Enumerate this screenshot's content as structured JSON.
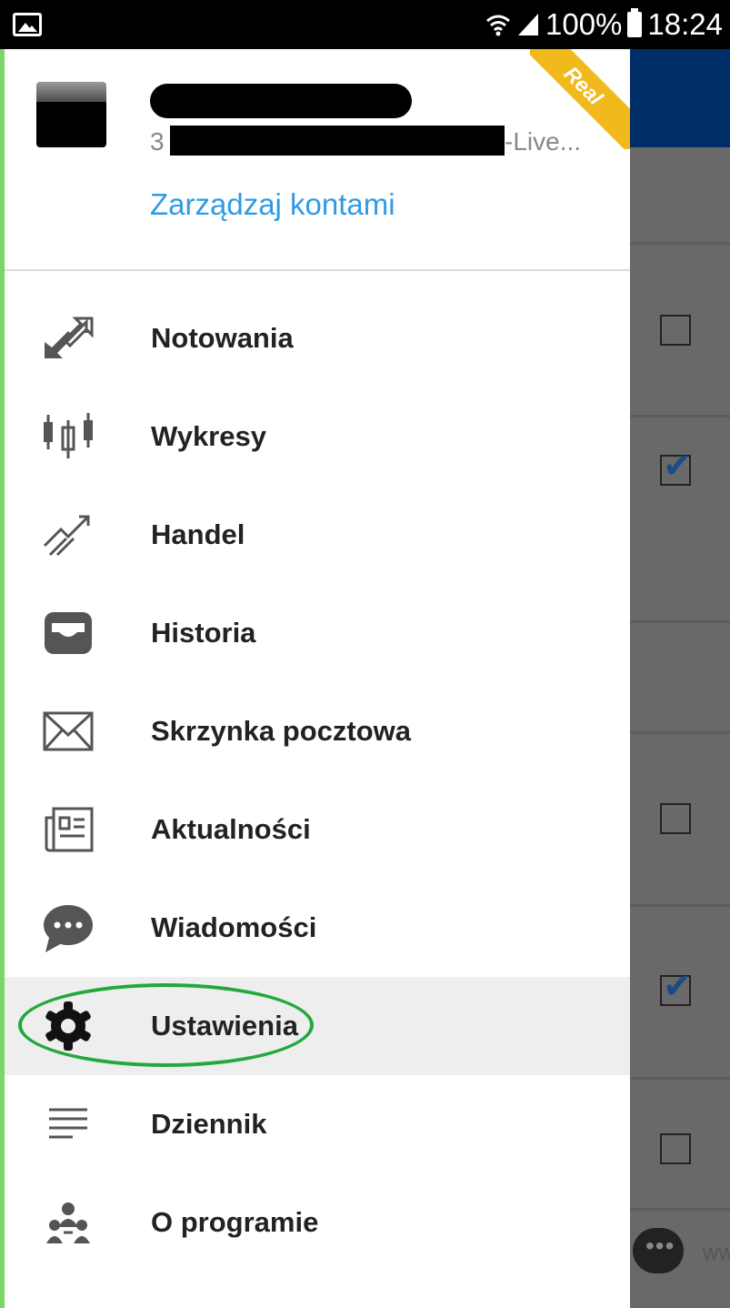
{
  "status_bar": {
    "battery": "100%",
    "time": "18:24",
    "icons": [
      "gallery-icon",
      "wifi-icon",
      "signal-icon",
      "battery-icon"
    ]
  },
  "drawer": {
    "account_number_prefix": "3",
    "account_suffix": "-Live...",
    "manage_accounts": "Zarządzaj kontami",
    "badge": "Real",
    "menu": [
      {
        "label": "Notowania",
        "icon": "quotes-arrows-icon"
      },
      {
        "label": "Wykresy",
        "icon": "candlestick-icon"
      },
      {
        "label": "Handel",
        "icon": "trade-trend-icon"
      },
      {
        "label": "Historia",
        "icon": "inbox-tray-icon"
      },
      {
        "label": "Skrzynka pocztowa",
        "icon": "envelope-icon"
      },
      {
        "label": "Aktualności",
        "icon": "newspaper-icon"
      },
      {
        "label": "Wiadomości",
        "icon": "chat-bubble-icon"
      },
      {
        "label": "Ustawienia",
        "icon": "gear-icon",
        "selected": true
      },
      {
        "label": "Dziennik",
        "icon": "lines-icon"
      },
      {
        "label": "O programie",
        "icon": "community-icon"
      }
    ]
  },
  "background_app": {
    "checkboxes": [
      false,
      true,
      false,
      true,
      false
    ],
    "footer_text": "ww",
    "accent": "#002d66"
  },
  "colors": {
    "link": "#2f9be5",
    "ribbon": "#f0b91c",
    "highlight": "#22a83c"
  }
}
